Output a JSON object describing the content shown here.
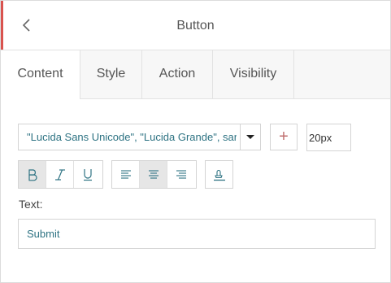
{
  "header": {
    "title": "Button",
    "back_icon": "chevron-left-icon"
  },
  "tabs": [
    {
      "label": "Content",
      "active": true
    },
    {
      "label": "Style",
      "active": false
    },
    {
      "label": "Action",
      "active": false
    },
    {
      "label": "Visibility",
      "active": false
    }
  ],
  "font": {
    "family_value": "\"Lucida Sans Unicode\", \"Lucida Grande\", sans-serif",
    "add_label": "+",
    "size_value": "20px"
  },
  "format_buttons": [
    {
      "name": "bold-icon",
      "active": true
    },
    {
      "name": "italic-icon",
      "active": false
    },
    {
      "name": "underline-icon",
      "active": false
    }
  ],
  "align_buttons": [
    {
      "name": "align-left-icon",
      "active": false
    },
    {
      "name": "align-center-icon",
      "active": true
    },
    {
      "name": "align-right-icon",
      "active": false
    }
  ],
  "extra_buttons": [
    {
      "name": "text-color-icon",
      "active": false
    }
  ],
  "text_field": {
    "label": "Text:",
    "value": "Submit"
  },
  "colors": {
    "accent": "#d9534f",
    "value_text": "#2e7383",
    "border": "#d4d4d4",
    "active_bg": "#e6e6e6"
  }
}
